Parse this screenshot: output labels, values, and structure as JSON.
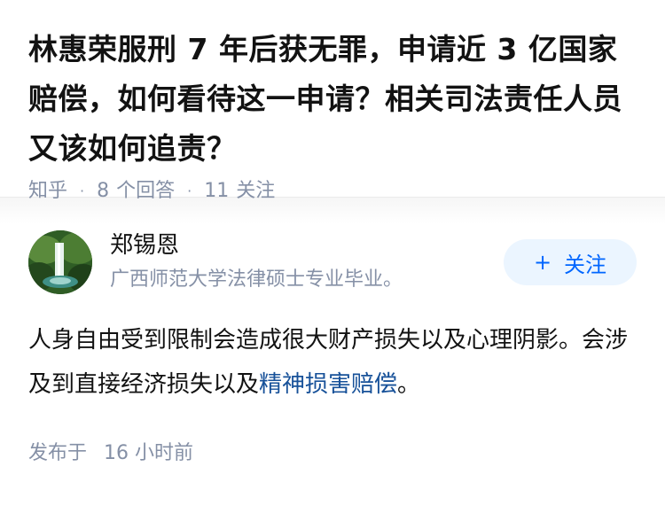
{
  "question": {
    "title": "林惠荣服刑 7 年后获无罪，申请近 3 亿国家赔偿，如何看待这一申请？相关司法责任人员又该如何追责？",
    "source": "知乎",
    "answer_count": "8",
    "answer_count_label": "个回答",
    "follower_count": "11",
    "follower_count_label": "关注"
  },
  "answer": {
    "author_name": "郑锡恩",
    "author_bio": "广西师范大学法律硕士专业毕业。",
    "follow_label": "关注",
    "follow_icon": "plus-icon",
    "text_before_link": "人身自由受到限制会造成很大财产损失以及心理阴影。会涉及到直接经济损失以及",
    "link_text": "精神损害赔偿",
    "text_after_link": "。",
    "published_label": "发布于",
    "published_time": "16 小时前"
  },
  "colors": {
    "accent": "#0066ff",
    "follow_bg": "#ebf5ff",
    "link": "#175199",
    "muted": "#8590a6"
  }
}
